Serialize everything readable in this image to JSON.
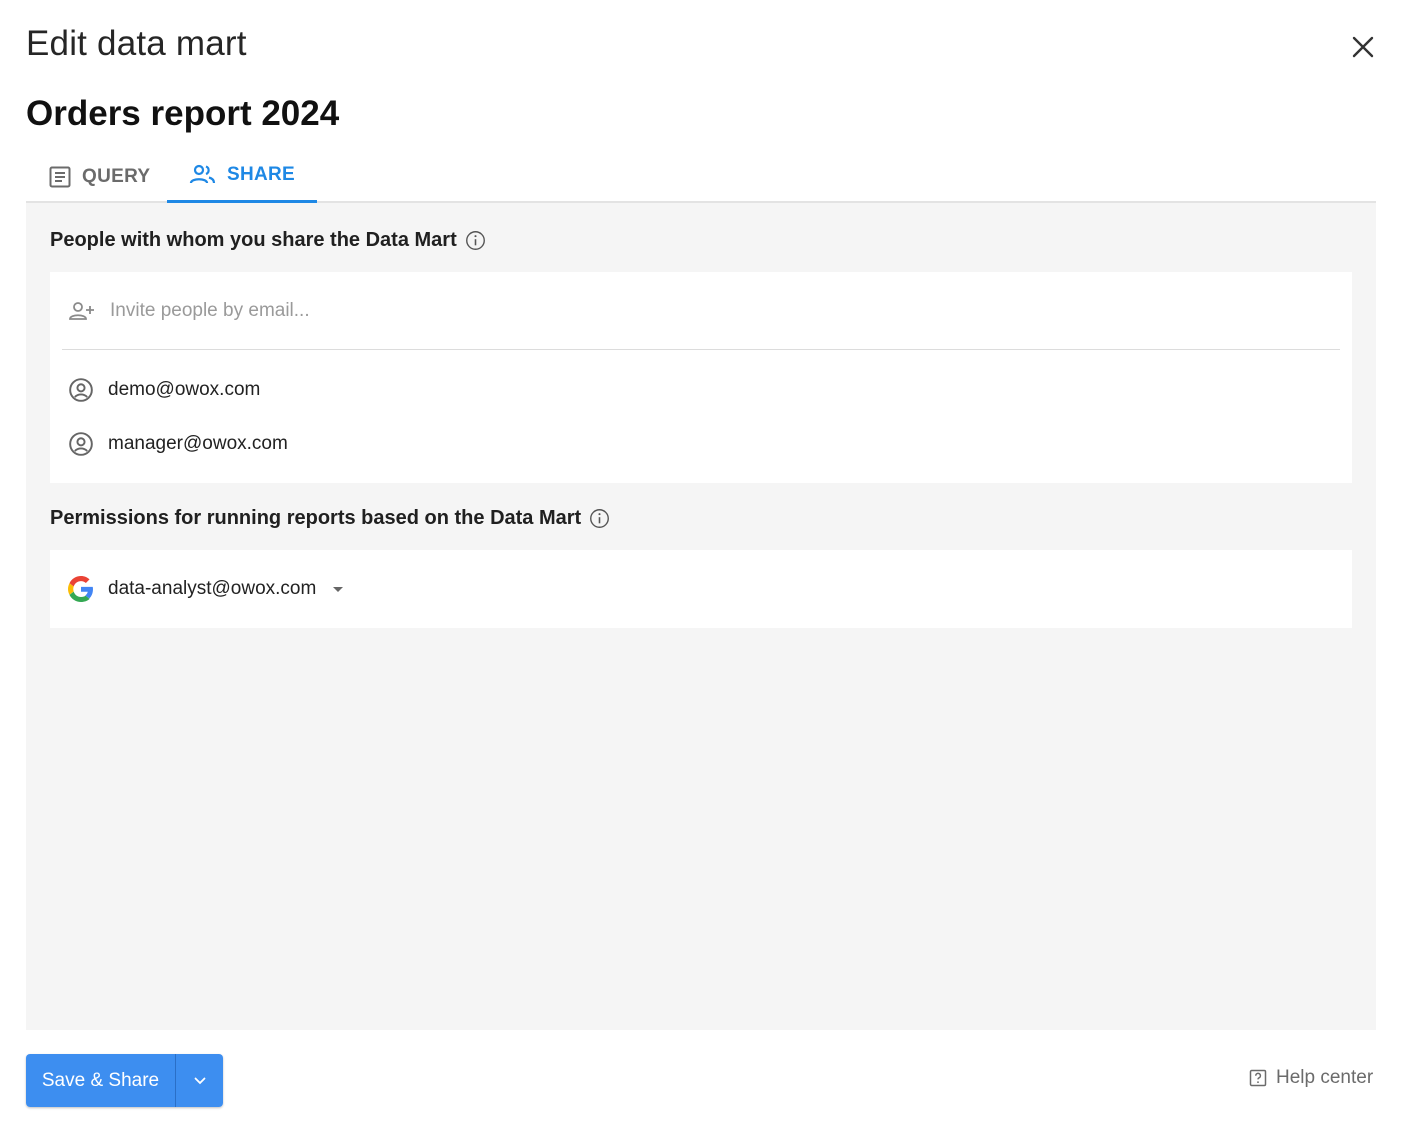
{
  "dialog": {
    "title": "Edit data mart",
    "data_mart_name": "Orders report 2024"
  },
  "tabs": [
    {
      "label": "QUERY",
      "icon": "article-icon",
      "active": false
    },
    {
      "label": "SHARE",
      "icon": "people-icon",
      "active": true
    }
  ],
  "share": {
    "people_section_title": "People with whom you share the Data Mart",
    "invite_placeholder": "Invite people by email...",
    "invite_value": "",
    "people": [
      {
        "email": "demo@owox.com",
        "icon": "account-circle-icon"
      },
      {
        "email": "manager@owox.com",
        "icon": "account-circle-icon"
      }
    ],
    "permissions_section_title": "Permissions for running reports based on the Data Mart",
    "permission_account": {
      "email": "data-analyst@owox.com",
      "icon": "google-icon"
    }
  },
  "footer": {
    "save_label": "Save & Share",
    "help_label": "Help center"
  },
  "colors": {
    "accent": "#1e88e5",
    "primary_button": "#3d8ef0",
    "content_background": "#f5f5f5"
  }
}
